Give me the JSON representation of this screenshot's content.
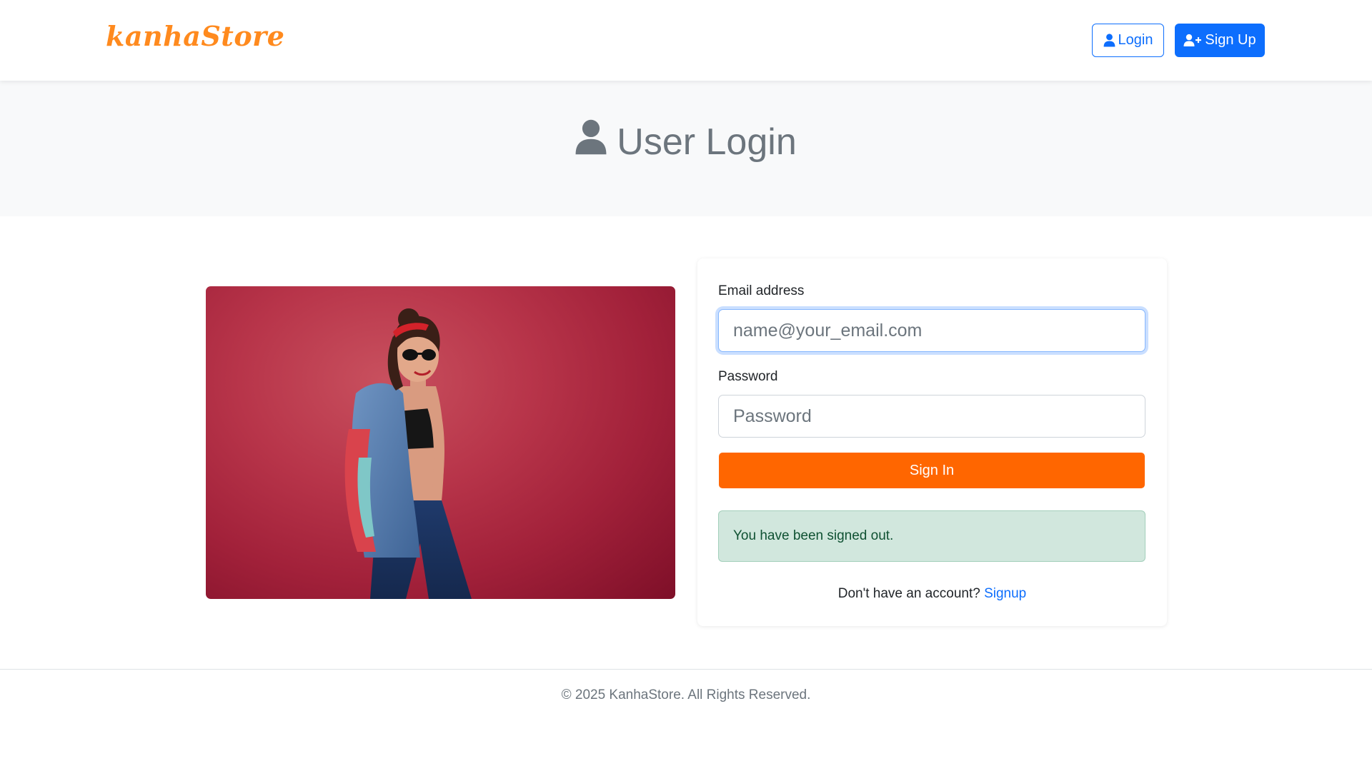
{
  "navbar": {
    "brand": "kanhaStore",
    "login_label": "Login",
    "signup_label": "Sign Up"
  },
  "hero": {
    "title": "User Login"
  },
  "form": {
    "email_label": "Email address",
    "email_placeholder": "name@your_email.com",
    "email_value": "",
    "password_label": "Password",
    "password_placeholder": "Password",
    "password_value": "",
    "submit_label": "Sign In",
    "alert_message": "You have been signed out.",
    "signup_prompt": "Don't have an account?",
    "signup_link": "Signup"
  },
  "footer": {
    "copyright": "© 2025 KanhaStore. All Rights Reserved."
  },
  "icons": {
    "login": "user-icon",
    "signup": "user-plus-icon",
    "hero": "user-icon"
  },
  "colors": {
    "brand": "#ff8a1e",
    "primary": "#0d6efd",
    "submit": "#ff6600",
    "alert_bg": "#d1e7dd",
    "alert_text": "#0f5132"
  }
}
